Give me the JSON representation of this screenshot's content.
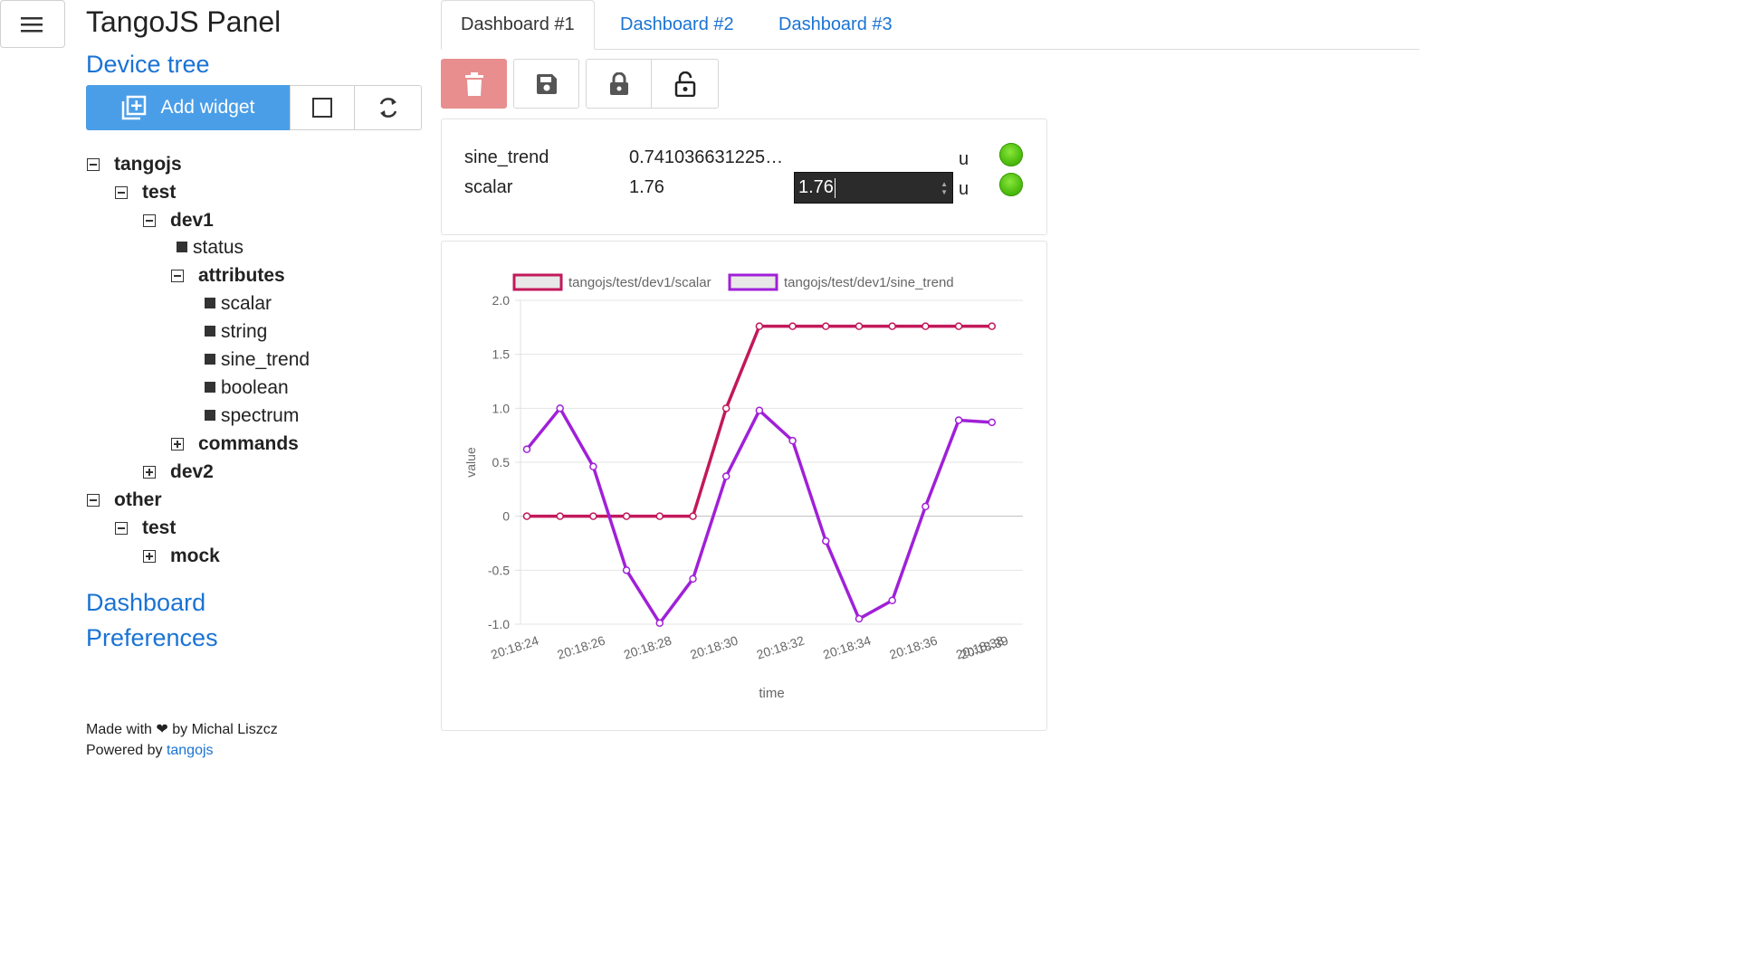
{
  "app": {
    "title": "TangoJS Panel"
  },
  "sidebar": {
    "device_tree_link": "Device tree",
    "add_widget_label": "Add widget",
    "dashboard_link": "Dashboard",
    "preferences_link": "Preferences",
    "tree": {
      "tangojs": "tangojs",
      "test": "test",
      "dev1": "dev1",
      "status": "status",
      "attributes": "attributes",
      "scalar": "scalar",
      "string": "string",
      "sine_trend": "sine_trend",
      "boolean": "boolean",
      "spectrum": "spectrum",
      "commands": "commands",
      "dev2": "dev2",
      "other": "other",
      "other_test": "test",
      "mock": "mock"
    },
    "footer": {
      "made_with": "Made with ❤ by Michal Liszcz",
      "powered_by": "Powered by ",
      "powered_link": "tangojs"
    }
  },
  "tabs": [
    "Dashboard #1",
    "Dashboard #2",
    "Dashboard #3"
  ],
  "toolbar": {
    "icons": [
      "trash-icon",
      "save-icon",
      "lock-icon",
      "unlock-icon"
    ],
    "delete_color": "#e88e8e"
  },
  "attributes_widget": {
    "rows": [
      {
        "name": "sine_trend",
        "value": "0.741036631225…",
        "unit": "u",
        "status": "ok"
      },
      {
        "name": "scalar",
        "value": "1.76",
        "input_value": "1.76",
        "unit": "u",
        "status": "ok"
      }
    ]
  },
  "chart_data": {
    "type": "line",
    "title": "",
    "xlabel": "time",
    "ylabel": "value",
    "ylim": [
      -1.0,
      2.0
    ],
    "y_ticks": [
      "2.0",
      "1.5",
      "1.0",
      "0.5",
      "0",
      "-0.5",
      "-1.0"
    ],
    "x_ticks": [
      "20:18:24",
      "20:18:26",
      "20:18:28",
      "20:18:30",
      "20:18:32",
      "20:18:34",
      "20:18:36",
      "20:18:38",
      "20:18:39"
    ],
    "x": [
      "20:18:24",
      "20:18:25",
      "20:18:26",
      "20:18:27",
      "20:18:28",
      "20:18:29",
      "20:18:30",
      "20:18:31",
      "20:18:32",
      "20:18:33",
      "20:18:34",
      "20:18:35",
      "20:18:36",
      "20:18:37",
      "20:18:38"
    ],
    "grid": true,
    "legend_position": "top",
    "series": [
      {
        "name": "tangojs/test/dev1/scalar",
        "color": "#c2185b",
        "values": [
          0,
          0,
          0,
          0,
          0,
          0,
          1.0,
          1.76,
          1.76,
          1.76,
          1.76,
          1.76,
          1.76,
          1.76,
          1.76
        ]
      },
      {
        "name": "tangojs/test/dev1/sine_trend",
        "color": "#a020d8",
        "values": [
          0.62,
          1.0,
          0.46,
          -0.5,
          -0.99,
          -0.58,
          0.37,
          0.98,
          0.7,
          -0.23,
          -0.95,
          -0.78,
          0.09,
          0.89,
          0.87
        ]
      }
    ]
  }
}
